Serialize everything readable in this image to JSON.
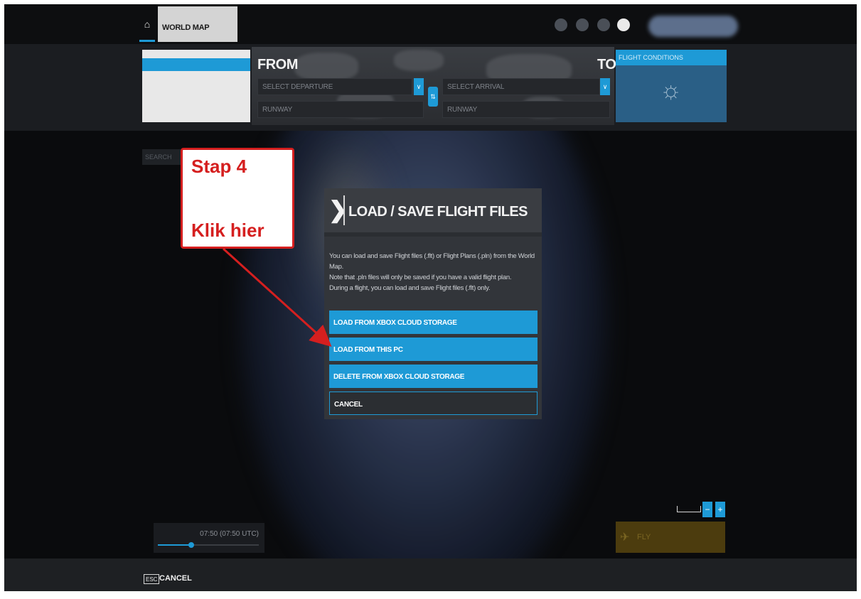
{
  "topbar": {
    "tab_label": "WORLD MAP"
  },
  "route": {
    "from_label": "FROM",
    "to_label": "TO",
    "departure_placeholder": "SELECT DEPARTURE",
    "arrival_placeholder": "SELECT ARRIVAL",
    "departure_runway": "RUNWAY",
    "arrival_runway": "RUNWAY"
  },
  "conditions": {
    "title": "FLIGHT CONDITIONS"
  },
  "search": {
    "label": "SEARCH"
  },
  "annotation": {
    "step": "Stap 4",
    "instruction": "Klik hier"
  },
  "dialog": {
    "title": "LOAD / SAVE FLIGHT FILES",
    "description_lines": [
      "You can load and save Flight files (.flt) or Flight Plans (.pln) from the World Map.",
      "Note that .pln files will only be saved if you have a valid flight plan.",
      "During a flight, you can load and save Flight files (.flt) only."
    ],
    "buttons": [
      "LOAD FROM XBOX CLOUD STORAGE",
      "LOAD FROM THIS PC",
      "DELETE FROM XBOX CLOUD STORAGE",
      "CANCEL"
    ]
  },
  "time": {
    "label": "07:50 (07:50 UTC)",
    "progress": 0.33
  },
  "fly": {
    "label": "FLY"
  },
  "footer": {
    "key": "ESC",
    "label": "CANCEL"
  },
  "colors": {
    "accent": "#1e9ad6",
    "annotation": "#d51f1f"
  }
}
